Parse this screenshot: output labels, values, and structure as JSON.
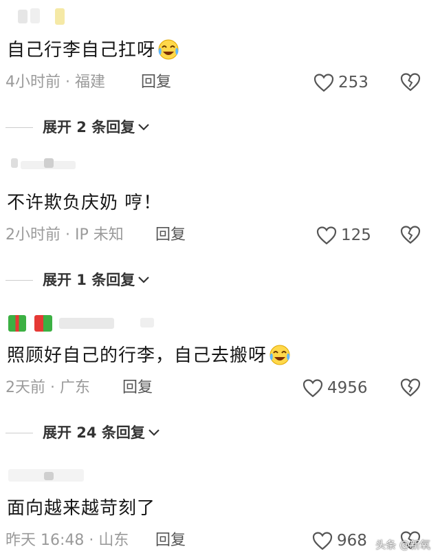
{
  "comments": [
    {
      "text": "自己行李自己扛呀",
      "meta": "4小时前 · 福建",
      "reply": "回复",
      "likes": "253",
      "expand": "展开 2 条回复"
    },
    {
      "text": "不许欺负庆奶 哼！",
      "meta": "2小时前 · IP 未知",
      "reply": "回复",
      "likes": "125",
      "expand": "展开 1 条回复"
    },
    {
      "text": "照顾好自己的行李，自己去搬呀",
      "meta": "2天前 · 广东",
      "reply": "回复",
      "likes": "4956",
      "expand": "展开 24 条回复"
    },
    {
      "text": "面向越来越苛刻了",
      "meta": "昨天 16:48 · 山东",
      "reply": "回复",
      "likes": "968"
    }
  ],
  "watermark": "头条 @新氧",
  "icons": {
    "like": "heart-outline-icon",
    "dislike": "broken-heart-icon",
    "expand": "chevron-down-icon",
    "emoji": "crying-laughing-emoji-icon"
  }
}
